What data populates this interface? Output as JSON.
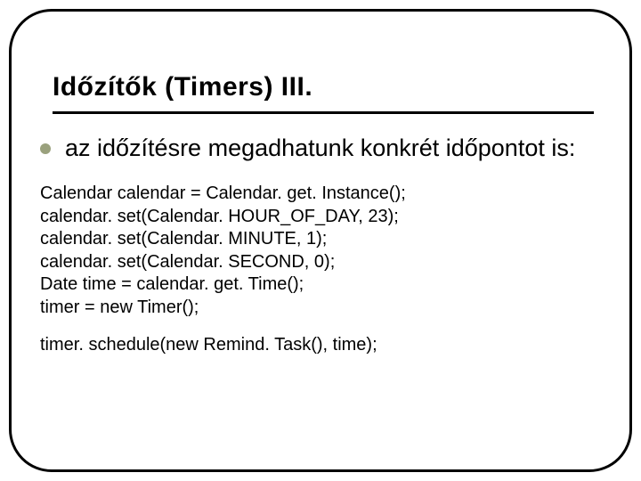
{
  "slide": {
    "title": "Időzítők (Timers) III.",
    "bullet": "az időzítésre megadhatunk konkrét időpontot is:",
    "code": {
      "l1": "Calendar calendar = Calendar. get. Instance();",
      "l2": "calendar. set(Calendar. HOUR_OF_DAY, 23);",
      "l3": "calendar. set(Calendar. MINUTE, 1);",
      "l4": "calendar. set(Calendar. SECOND, 0);",
      "l5": "Date time = calendar. get. Time();",
      "l6": "timer = new Timer();",
      "l7": "timer. schedule(new Remind. Task(), time);"
    }
  }
}
